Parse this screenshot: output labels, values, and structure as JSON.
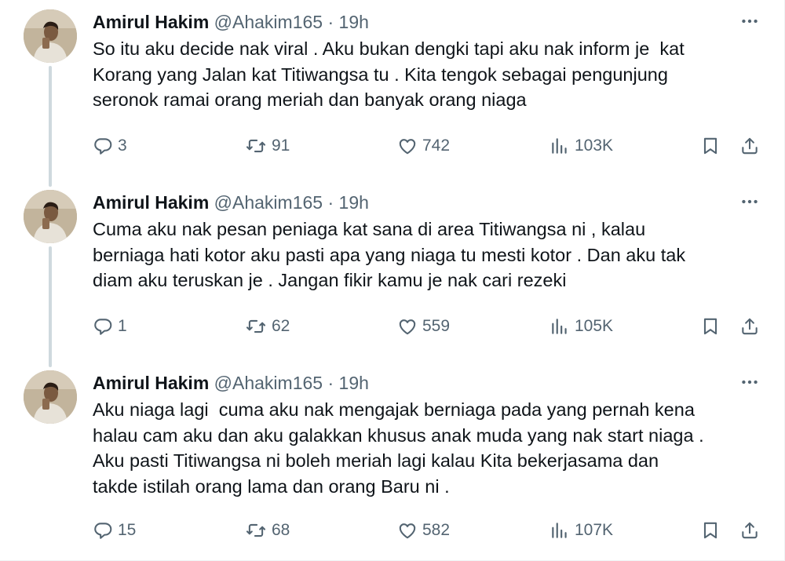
{
  "tweets": [
    {
      "author": {
        "name": "Amirul Hakim",
        "handle": "@Ahakim165",
        "time": "19h"
      },
      "text": "So itu aku decide nak viral . Aku bukan dengki tapi aku nak inform je  kat\nKorang yang Jalan kat Titiwangsa tu . Kita tengok sebagai pengunjung\nseronok ramai orang meriah dan banyak orang niaga",
      "stats": {
        "replies": "3",
        "reposts": "91",
        "likes": "742",
        "views": "103K"
      }
    },
    {
      "author": {
        "name": "Amirul Hakim",
        "handle": "@Ahakim165",
        "time": "19h"
      },
      "text": "Cuma aku nak pesan peniaga kat sana di area Titiwangsa ni , kalau\nberniaga hati kotor aku pasti apa yang niaga tu mesti kotor . Dan aku tak\ndiam aku teruskan je . Jangan fikir kamu je nak cari rezeki",
      "stats": {
        "replies": "1",
        "reposts": "62",
        "likes": "559",
        "views": "105K"
      }
    },
    {
      "author": {
        "name": "Amirul Hakim",
        "handle": "@Ahakim165",
        "time": "19h"
      },
      "text": "Aku niaga lagi  cuma aku nak mengajak berniaga pada yang pernah kena\nhalau cam aku dan aku galakkan khusus anak muda yang nak start niaga .\nAku pasti Titiwangsa ni boleh meriah lagi kalau Kita bekerjasama dan\ntakde istilah orang lama dan orang Baru ni .",
      "stats": {
        "replies": "15",
        "reposts": "68",
        "likes": "582",
        "views": "107K"
      }
    }
  ],
  "separator": "·",
  "icons": {
    "more": "more-horizontal-icon",
    "reply": "reply-icon",
    "repost": "repost-icon",
    "like": "heart-icon",
    "views": "views-chart-icon",
    "bookmark": "bookmark-icon",
    "share": "share-icon"
  },
  "colors": {
    "text": "#0f1419",
    "secondary": "#536471",
    "thread_line": "#cfd9de"
  }
}
